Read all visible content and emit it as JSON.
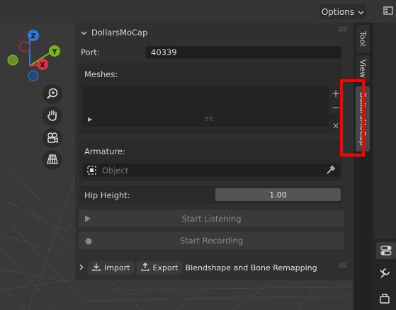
{
  "header": {
    "options_label": "Options"
  },
  "addon_panel": {
    "title": "DollarsMoCap",
    "port_label": "Port:",
    "port_value": "40339",
    "meshes_label": "Meshes:",
    "meshes_add": "+",
    "meshes_remove": "−",
    "meshes_clear": "✕",
    "armature_label": "Armature:",
    "armature_placeholder": "Object",
    "hip_height_label": "Hip Height:",
    "hip_height_value": "1.00",
    "start_listening": "Start Listening",
    "start_recording": "Start Recording"
  },
  "remap_section": {
    "import_label": "Import",
    "export_label": "Export",
    "title": "Blendshape and Bone Remapping"
  },
  "sidebar_tabs": [
    "Tool",
    "View",
    "DollarsMoCap"
  ],
  "gizmo": {
    "z": "Z",
    "y": "Y",
    "x": "X"
  },
  "colors": {
    "highlight": "#ff0000",
    "x_axis": "#e0304a",
    "y_axis": "#7bb31a",
    "z_axis": "#2e7ad6"
  }
}
